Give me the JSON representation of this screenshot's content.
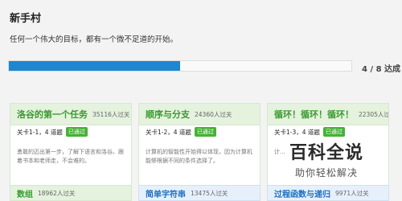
{
  "page": {
    "title": "新手村",
    "subtitle": "任何一个伟大的目标，都有一个微不足道的开始。"
  },
  "progress": {
    "fraction": 0.5,
    "text": "4 / 8 达成"
  },
  "cards": [
    {
      "title": "洛谷的第一个任务",
      "passed": "35116人过关",
      "meta": "关卡1-1，4 道题",
      "badge": "已通过",
      "desc": "勇敢的迈出第一步，了解下语言和洛谷。跟着书本和老师走，不会难的。"
    },
    {
      "title": "顺序与分支",
      "passed": "24360人过关",
      "meta": "关卡1-2，4 道题",
      "badge": "已通过",
      "desc": "计算机的智能性开始得以体现，因为计算机能够根据不同的条件选择了。"
    },
    {
      "title": "循环！循环！循环！",
      "passed": "22305人过关",
      "meta": "关卡1-3，4 道题",
      "badge": "已通过",
      "desc": "计..."
    }
  ],
  "bottom_cards": [
    {
      "title": "数组",
      "passed": "18962人过关"
    },
    {
      "title": "简单字符串",
      "passed": "13475人过关"
    },
    {
      "title": "过程函数与递归",
      "passed": "9971人过关"
    }
  ],
  "watermark": {
    "main": "百科全说",
    "sub": "助你轻松解决"
  }
}
